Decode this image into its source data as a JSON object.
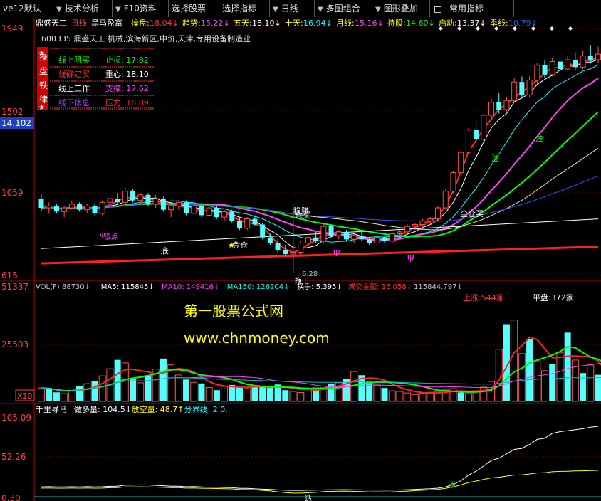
{
  "toolbar": [
    {
      "label": "ve12默认",
      "arrow": false
    },
    {
      "label": "技术分析",
      "arrow": true
    },
    {
      "label": "F10资料",
      "arrow": true
    },
    {
      "label": "选择股票",
      "arrow": false
    },
    {
      "label": "选择指标",
      "arrow": false
    },
    {
      "label": "日线",
      "arrow": true
    },
    {
      "label": "多图组合",
      "arrow": true
    },
    {
      "label": "图形叠加",
      "arrow": true
    },
    {
      "label": "常用指标",
      "arrow": false
    }
  ],
  "price_panel": {
    "top_axis_label": "1949",
    "mid_axis_label": "1502",
    "current_price": "14.102",
    "axis_1059": "1059",
    "axis_bottom": "615",
    "header": {
      "stock_name": "鼎盛天工",
      "period": "日线",
      "strategy": "黑马盈富",
      "items": [
        {
          "label": "操盘",
          "value": "18.04",
          "color": "#ff3030"
        },
        {
          "label": "趋势",
          "value": "15.22",
          "color": "#ff40ff"
        },
        {
          "label": "五天",
          "value": "18.10",
          "color": "#ffffff"
        },
        {
          "label": "十天",
          "value": "16.94",
          "color": "#00ffff"
        },
        {
          "label": "月线",
          "value": "15.16",
          "color": "#ff40ff"
        },
        {
          "label": "持股",
          "value": "14.60",
          "color": "#00ff00"
        },
        {
          "label": "启动",
          "value": "13.37",
          "color": "#ffffff"
        },
        {
          "label": "季线",
          "value": "10.79",
          "color": "#3060ff"
        }
      ]
    },
    "stock_info": "600335 鼎盛天工 机械,滨海新区,中价,天津,专用设备制造业",
    "side_panel_title": [
      "操",
      "盘",
      "铁",
      "律"
    ],
    "rules": [
      {
        "left": "线上阴买",
        "left_color": "#00ff00",
        "right_label": "止损",
        "right_value": "17.82",
        "right_color": "#00ff00"
      },
      {
        "left": "线确定买",
        "left_color": "#ff3030",
        "right_label": "重心",
        "right_value": "18.10",
        "right_color": "#ffffff"
      },
      {
        "left": "线上工作",
        "left_color": "#ffffff",
        "right_label": "支撑",
        "right_value": "17.62",
        "right_color": "#ff40ff"
      },
      {
        "left": "线下休息",
        "left_color": "#a040ff",
        "right_label": "压力",
        "right_value": "18.89",
        "right_color": "#ff3030"
      }
    ],
    "annotations": {
      "bottom_label": "底",
      "buy_gold": "金仓",
      "steady_hold": "稳赚",
      "pos_buy": "仓买",
      "full_buy": "全仓买",
      "low_price": "6.28",
      "pin_label": "挣",
      "left_pt": "低点",
      "top_note1": "注",
      "top_note2": "注"
    }
  },
  "volume_panel": {
    "axis_top": "51337",
    "axis_mid": "25503",
    "axis_unit": "X10",
    "header": [
      {
        "text": "VOL(F) 88730↓",
        "color": "#c0c0c0"
      },
      {
        "text": "MA5: 115845↓",
        "color": "#ffffff"
      },
      {
        "text": "MA10: 149416↓",
        "color": "#ff40ff"
      },
      {
        "text": "MA150: 126204↓",
        "color": "#00ffff"
      },
      {
        "text": "换手: 5.395↓",
        "color": "#ffffff"
      },
      {
        "text": "成交金额: 16.058↓",
        "color": "#ff3030"
      },
      {
        "text": "115844.797↓",
        "color": "#c0c0c0"
      }
    ],
    "up_count": "上涨:544家",
    "flat_count": "平盘:372家",
    "watermark_1": "第一股票公式网",
    "watermark_2": "www.chnmoney.com"
  },
  "oscillator_panel": {
    "title": "千里寻马",
    "header": [
      {
        "text": "做多量: 104.5↓",
        "color": "#ffffff"
      },
      {
        "text": "放空量: 48.7↑",
        "color": "#ffff00"
      },
      {
        "text": "分界线: 2.0,",
        "color": "#00ffff"
      }
    ],
    "axis_top": "105.09",
    "axis_mid": "52.26",
    "axis_bottom": "0.30",
    "pin_label": "添",
    "pin_label2": "适"
  },
  "colors": {
    "up": "#ff5050",
    "down": "#54ffff",
    "bg": "#000000",
    "grid": "#800000"
  },
  "chart_data": [
    {
      "type": "candlestick",
      "title": "鼎盛天工 日线",
      "ylim": [
        6.15,
        19.49
      ],
      "candles": [
        {
          "o": 10.3,
          "h": 10.5,
          "l": 9.6,
          "c": 9.8
        },
        {
          "o": 9.8,
          "h": 10.1,
          "l": 9.5,
          "c": 9.9
        },
        {
          "o": 9.9,
          "h": 10.0,
          "l": 9.5,
          "c": 9.6
        },
        {
          "o": 9.6,
          "h": 9.9,
          "l": 9.3,
          "c": 9.8
        },
        {
          "o": 9.8,
          "h": 10.2,
          "l": 9.7,
          "c": 10.0
        },
        {
          "o": 10.0,
          "h": 10.1,
          "l": 9.6,
          "c": 9.7
        },
        {
          "o": 9.7,
          "h": 10.0,
          "l": 9.5,
          "c": 9.9
        },
        {
          "o": 9.9,
          "h": 10.0,
          "l": 9.4,
          "c": 9.5
        },
        {
          "o": 9.5,
          "h": 10.2,
          "l": 9.4,
          "c": 10.1
        },
        {
          "o": 10.1,
          "h": 10.5,
          "l": 9.9,
          "c": 10.3
        },
        {
          "o": 10.3,
          "h": 10.6,
          "l": 10.0,
          "c": 10.1
        },
        {
          "o": 10.1,
          "h": 10.9,
          "l": 10.0,
          "c": 10.7
        },
        {
          "o": 10.7,
          "h": 10.8,
          "l": 10.1,
          "c": 10.2
        },
        {
          "o": 10.2,
          "h": 10.6,
          "l": 10.0,
          "c": 10.5
        },
        {
          "o": 10.5,
          "h": 10.6,
          "l": 9.9,
          "c": 10.0
        },
        {
          "o": 10.0,
          "h": 10.5,
          "l": 9.8,
          "c": 10.3
        },
        {
          "o": 10.3,
          "h": 10.4,
          "l": 9.6,
          "c": 9.7
        },
        {
          "o": 9.7,
          "h": 10.0,
          "l": 9.3,
          "c": 9.9
        },
        {
          "o": 9.9,
          "h": 10.2,
          "l": 9.7,
          "c": 10.1
        },
        {
          "o": 10.1,
          "h": 10.2,
          "l": 9.4,
          "c": 9.5
        },
        {
          "o": 9.5,
          "h": 10.0,
          "l": 9.4,
          "c": 9.9
        },
        {
          "o": 9.9,
          "h": 10.0,
          "l": 9.3,
          "c": 9.4
        },
        {
          "o": 9.4,
          "h": 9.9,
          "l": 9.3,
          "c": 9.8
        },
        {
          "o": 9.8,
          "h": 9.9,
          "l": 9.2,
          "c": 9.3
        },
        {
          "o": 9.3,
          "h": 9.7,
          "l": 9.1,
          "c": 9.6
        },
        {
          "o": 9.6,
          "h": 9.7,
          "l": 9.0,
          "c": 9.1
        },
        {
          "o": 9.1,
          "h": 9.3,
          "l": 8.6,
          "c": 8.7
        },
        {
          "o": 8.7,
          "h": 9.3,
          "l": 8.6,
          "c": 9.2
        },
        {
          "o": 9.2,
          "h": 9.4,
          "l": 8.8,
          "c": 8.9
        },
        {
          "o": 8.9,
          "h": 9.0,
          "l": 8.1,
          "c": 8.2
        },
        {
          "o": 8.2,
          "h": 8.4,
          "l": 7.8,
          "c": 7.9
        },
        {
          "o": 7.9,
          "h": 8.1,
          "l": 7.4,
          "c": 7.5
        },
        {
          "o": 7.5,
          "h": 7.8,
          "l": 7.2,
          "c": 7.3
        },
        {
          "o": 7.3,
          "h": 7.6,
          "l": 6.3,
          "c": 7.4
        },
        {
          "o": 7.4,
          "h": 8.0,
          "l": 7.2,
          "c": 7.9
        },
        {
          "o": 7.9,
          "h": 8.3,
          "l": 7.7,
          "c": 8.2
        },
        {
          "o": 8.2,
          "h": 8.5,
          "l": 7.9,
          "c": 8.0
        },
        {
          "o": 8.0,
          "h": 8.9,
          "l": 7.9,
          "c": 8.8
        },
        {
          "o": 8.8,
          "h": 8.9,
          "l": 8.2,
          "c": 8.3
        },
        {
          "o": 8.3,
          "h": 8.6,
          "l": 8.1,
          "c": 8.5
        },
        {
          "o": 8.5,
          "h": 8.6,
          "l": 8.0,
          "c": 8.1
        },
        {
          "o": 8.1,
          "h": 8.4,
          "l": 7.9,
          "c": 8.3
        },
        {
          "o": 8.3,
          "h": 8.5,
          "l": 8.0,
          "c": 8.1
        },
        {
          "o": 8.1,
          "h": 8.2,
          "l": 7.8,
          "c": 7.9
        },
        {
          "o": 7.9,
          "h": 8.3,
          "l": 7.8,
          "c": 8.2
        },
        {
          "o": 8.2,
          "h": 8.3,
          "l": 7.9,
          "c": 8.0
        },
        {
          "o": 8.0,
          "h": 8.5,
          "l": 7.9,
          "c": 8.4
        },
        {
          "o": 8.4,
          "h": 8.6,
          "l": 8.2,
          "c": 8.5
        },
        {
          "o": 8.5,
          "h": 8.9,
          "l": 8.4,
          "c": 8.8
        },
        {
          "o": 8.8,
          "h": 9.0,
          "l": 8.6,
          "c": 8.9
        },
        {
          "o": 8.9,
          "h": 9.2,
          "l": 8.7,
          "c": 9.1
        },
        {
          "o": 9.1,
          "h": 9.3,
          "l": 8.9,
          "c": 9.2
        },
        {
          "o": 9.2,
          "h": 9.9,
          "l": 9.1,
          "c": 9.8
        },
        {
          "o": 9.8,
          "h": 10.8,
          "l": 9.7,
          "c": 10.7
        },
        {
          "o": 10.7,
          "h": 11.8,
          "l": 10.6,
          "c": 11.7
        },
        {
          "o": 11.7,
          "h": 12.9,
          "l": 11.6,
          "c": 12.8
        },
        {
          "o": 12.8,
          "h": 14.1,
          "l": 12.7,
          "c": 14.0
        },
        {
          "o": 14.0,
          "h": 14.5,
          "l": 13.1,
          "c": 13.5
        },
        {
          "o": 13.5,
          "h": 14.9,
          "l": 13.4,
          "c": 14.8
        },
        {
          "o": 14.8,
          "h": 15.7,
          "l": 14.6,
          "c": 15.5
        },
        {
          "o": 15.5,
          "h": 16.0,
          "l": 14.9,
          "c": 15.1
        },
        {
          "o": 15.1,
          "h": 15.8,
          "l": 15.0,
          "c": 15.6
        },
        {
          "o": 15.6,
          "h": 16.8,
          "l": 15.5,
          "c": 16.6
        },
        {
          "o": 16.6,
          "h": 16.9,
          "l": 15.7,
          "c": 15.9
        },
        {
          "o": 15.9,
          "h": 16.9,
          "l": 15.8,
          "c": 16.7
        },
        {
          "o": 16.7,
          "h": 17.6,
          "l": 16.5,
          "c": 17.5
        },
        {
          "o": 17.5,
          "h": 17.8,
          "l": 16.8,
          "c": 17.0
        },
        {
          "o": 17.0,
          "h": 17.9,
          "l": 16.9,
          "c": 17.7
        },
        {
          "o": 17.7,
          "h": 18.1,
          "l": 17.1,
          "c": 17.3
        },
        {
          "o": 17.3,
          "h": 18.0,
          "l": 17.2,
          "c": 17.8
        },
        {
          "o": 17.8,
          "h": 18.2,
          "l": 17.2,
          "c": 17.4
        },
        {
          "o": 17.4,
          "h": 18.3,
          "l": 17.3,
          "c": 18.0
        },
        {
          "o": 18.0,
          "h": 18.6,
          "l": 17.6,
          "c": 17.8
        },
        {
          "o": 17.8,
          "h": 18.5,
          "l": 17.6,
          "c": 18.1
        }
      ]
    },
    {
      "type": "bar",
      "title": "VOL(F)",
      "ylim": [
        0,
        51337
      ],
      "values": [
        6200,
        5800,
        4200,
        3600,
        5100,
        6900,
        8200,
        9400,
        11800,
        15100,
        19200,
        17800,
        10200,
        8600,
        12100,
        14900,
        19800,
        16900,
        12200,
        10100,
        8800,
        8300,
        6400,
        5200,
        6900,
        7600,
        6800,
        5900,
        7100,
        6600,
        6300,
        7800,
        5200,
        4600,
        4100,
        5900,
        6400,
        7100,
        7900,
        8600,
        10400,
        13800,
        12100,
        9100,
        7600,
        6200,
        4900,
        4600,
        3900,
        3200,
        3700,
        4200,
        4600,
        5300,
        5900,
        4100,
        3600,
        4900,
        6600,
        9200,
        24100,
        35700,
        37600,
        22100,
        28900,
        18800,
        14200,
        17200,
        22600,
        31800,
        19100,
        13100,
        16800,
        12300,
        10800,
        6900,
        10100
      ],
      "ups": [
        true,
        false,
        false,
        true,
        true,
        false,
        true,
        false,
        true,
        true,
        false,
        true,
        false,
        true,
        false,
        true,
        false,
        true,
        true,
        false,
        true,
        false,
        true,
        false,
        true,
        false,
        false,
        true,
        false,
        false,
        false,
        false,
        false,
        true,
        true,
        true,
        false,
        true,
        false,
        true,
        false,
        true,
        false,
        false,
        true,
        false,
        true,
        true,
        true,
        true,
        true,
        true,
        true,
        true,
        true,
        false,
        true,
        true,
        true,
        true,
        true,
        false,
        true,
        true,
        false,
        true,
        true,
        false,
        true,
        false,
        true,
        false,
        true,
        false,
        true,
        false,
        true
      ]
    },
    {
      "type": "line",
      "title": "千里寻马",
      "ylim": [
        0.3,
        105.09
      ],
      "series": [
        {
          "name": "做多量",
          "color": "#ffffff"
        },
        {
          "name": "放空量",
          "color": "#ffff00"
        },
        {
          "name": "分界线",
          "color": "#00ffff"
        }
      ]
    }
  ]
}
